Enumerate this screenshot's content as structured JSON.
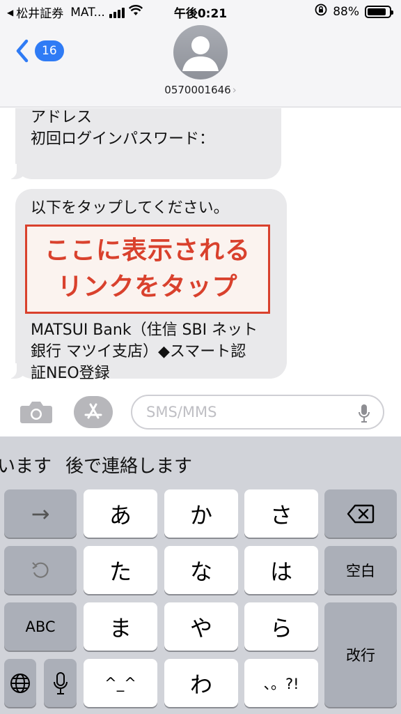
{
  "status_bar": {
    "back_app": "松井証券",
    "carrier": "MAT...",
    "time": "午後0:21",
    "battery": "88%",
    "battery_level": 0.88
  },
  "header": {
    "unread_count": "16",
    "contact_number": "0570001646"
  },
  "messages": [
    {
      "lines": [
        "アドレス",
        "初回ログインパスワード："
      ]
    },
    {
      "intro": "以下をタップしてください。",
      "callout": [
        "ここに表示される",
        "リンクをタップ"
      ],
      "lines": [
        "MATSUI Bank（住信 SBI ネット",
        "銀行 マツイ支店）◆スマート認",
        "証NEO登録"
      ]
    }
  ],
  "input": {
    "placeholder": "SMS/MMS"
  },
  "keyboard": {
    "predictions": [
      "います",
      "後で連絡します"
    ],
    "rows": [
      [
        "→",
        "あ",
        "か",
        "さ",
        "⌫"
      ],
      [
        "↺",
        "た",
        "な",
        "は",
        "空白"
      ],
      [
        "ABC",
        "ま",
        "や",
        "ら",
        "改行"
      ],
      [
        "🌐",
        "🎤",
        "^_^",
        "わ",
        "、。?!"
      ]
    ],
    "labels": {
      "arrow": "→",
      "a": "あ",
      "ka": "か",
      "sa": "さ",
      "ta": "た",
      "na": "な",
      "ha": "は",
      "space": "空白",
      "abc": "ABC",
      "ma": "ま",
      "ya": "や",
      "ra": "ら",
      "return": "改行",
      "emoticon": "^_^",
      "wa": "わ",
      "punct": "、。?!"
    }
  }
}
